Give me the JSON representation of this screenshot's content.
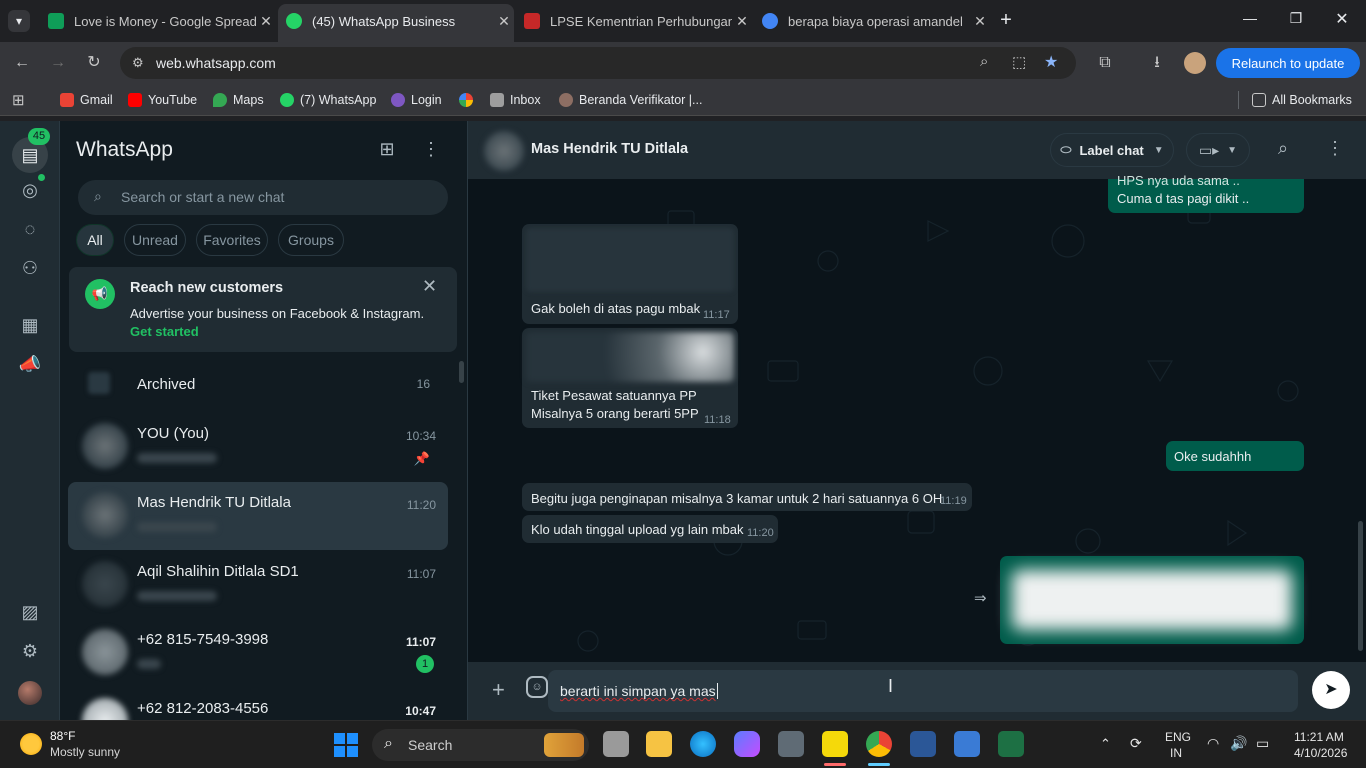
{
  "browser": {
    "tabs": [
      {
        "title": "Love is Money - Google Spread",
        "active": false,
        "favicon_color": "#0f9d58"
      },
      {
        "title": "(45) WhatsApp Business",
        "active": true,
        "favicon_color": "#25d366"
      },
      {
        "title": "LPSE Kementrian Perhubungan",
        "active": false,
        "favicon_color": "#c62828"
      },
      {
        "title": "berapa biaya operasi amandel",
        "active": false,
        "favicon_color": "#4285f4"
      }
    ],
    "new_tab_label": "+",
    "address": "web.whatsapp.com",
    "relaunch_label": "Relaunch to update",
    "bookmarks": [
      {
        "label": "Gmail",
        "color": "#ea4335"
      },
      {
        "label": "YouTube",
        "color": "#ff0000"
      },
      {
        "label": "Maps",
        "color": "#34a853"
      },
      {
        "label": "(7) WhatsApp",
        "color": "#25d366"
      },
      {
        "label": "Login",
        "color": "#7e57c2"
      },
      {
        "label": "",
        "color": "#fbbc04"
      },
      {
        "label": "Inbox",
        "color": "#9e9e9e"
      },
      {
        "label": "Beranda Verifikator |...",
        "color": "#8d6e63"
      }
    ],
    "all_bookmarks_label": "All Bookmarks"
  },
  "whatsapp": {
    "app_title": "WhatsApp",
    "rail_badge": "45",
    "search_placeholder": "Search or start a new chat",
    "filters": [
      "All",
      "Unread",
      "Favorites",
      "Groups"
    ],
    "promo": {
      "title": "Reach new customers",
      "body": "Advertise your business on Facebook & Instagram.",
      "link": "Get started"
    },
    "archived": {
      "label": "Archived",
      "count": "16"
    },
    "chats": [
      {
        "name": "YOU (You)",
        "time": "10:34",
        "pinned": true,
        "unread": ""
      },
      {
        "name": "Mas Hendrik TU Ditlala",
        "time": "11:20",
        "selected": true,
        "unread": ""
      },
      {
        "name": "Aqil Shalihin Ditlala SD1",
        "time": "11:07",
        "unread": ""
      },
      {
        "name": "+62 815-7549-3998",
        "time": "11:07",
        "unread": "1"
      },
      {
        "name": "+62 812-2083-4556",
        "time": "10:47",
        "unread": ""
      }
    ],
    "conversation": {
      "contact_name": "Mas Hendrik TU Ditlala",
      "label_chat": "Label chat",
      "messages": [
        {
          "dir": "out",
          "text1": "HPS nya uda sama ..",
          "text2": "Cuma d tas pagi dikit ..",
          "time": ""
        },
        {
          "dir": "in",
          "text": "Gak boleh di atas pagu mbak",
          "time": "11:17"
        },
        {
          "dir": "in",
          "text1": "Tiket Pesawat satuannya PP",
          "text2": "Misalnya 5 orang  berarti 5PP",
          "time": "11:18"
        },
        {
          "dir": "out",
          "text": "Oke sudahhh",
          "time": ""
        },
        {
          "dir": "in",
          "text": "Begitu juga penginapan misalnya 3 kamar untuk 2 hari satuannya 6 OH",
          "time": "11:19"
        },
        {
          "dir": "in",
          "text": "Klo udah tinggal upload yg lain mbak",
          "time": "11:20"
        }
      ],
      "composer_text": "berarti ini simpan ya mas"
    }
  },
  "taskbar": {
    "weather_temp": "88°F",
    "weather_desc": "Mostly sunny",
    "search_label": "Search",
    "lang1": "ENG",
    "lang2": "IN",
    "time": "11:21 AM",
    "date": "4/10/2026"
  }
}
